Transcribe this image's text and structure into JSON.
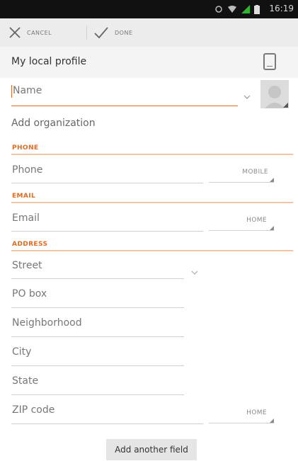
{
  "status_bar": {
    "time": "16:19"
  },
  "action_bar": {
    "cancel_label": "CANCEL",
    "done_label": "DONE"
  },
  "profile": {
    "title": "My local profile"
  },
  "fields": {
    "name_placeholder": "Name",
    "add_organization": "Add organization"
  },
  "phone_section": {
    "title": "PHONE",
    "placeholder": "Phone",
    "type": "MOBILE"
  },
  "email_section": {
    "title": "EMAIL",
    "placeholder": "Email",
    "type": "HOME"
  },
  "address_section": {
    "title": "ADDRESS",
    "street": "Street",
    "po_box": "PO box",
    "neighborhood": "Neighborhood",
    "city": "City",
    "state": "State",
    "zip": "ZIP code",
    "type": "HOME"
  },
  "add_field_button": "Add another field",
  "colors": {
    "accent": "#e26b21",
    "statusbar": "#111111",
    "actionbar": "#ececec"
  }
}
